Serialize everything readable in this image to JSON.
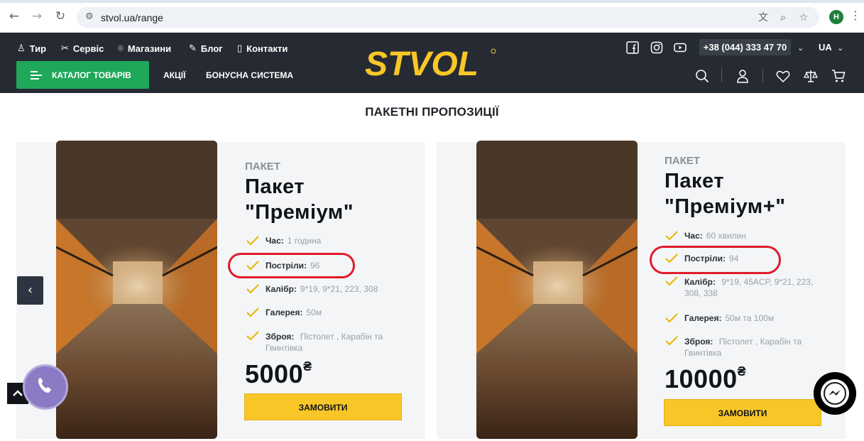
{
  "browser": {
    "url": "stvol.ua/range",
    "profile_initial": "H"
  },
  "header": {
    "top_links": [
      {
        "label": "Тир",
        "icon": "shooter-icon"
      },
      {
        "label": "Сервіс",
        "icon": "tools-icon"
      },
      {
        "label": "Магазини",
        "icon": "location-pin-icon"
      },
      {
        "label": "Блог",
        "icon": "pen-icon"
      },
      {
        "label": "Контакти",
        "icon": "phone-device-icon"
      }
    ],
    "phone": "+38 (044) 333 47 70",
    "language": "UA",
    "catalog_label": "КАТАЛОГ ТОВАРІВ",
    "nav": [
      "АКЦІЇ",
      "БОНУСНА СИСТЕМА"
    ],
    "logo_text": "STVOL",
    "colors": {
      "header_bg": "#262b33",
      "catalog_green": "#1fa75a",
      "brand_yellow": "#f8c627"
    }
  },
  "section_title": "ПАКЕТНІ ПРОПОЗИЦІЇ",
  "packages": [
    {
      "kicker": "ПАКЕТ",
      "name_line1": "Пакет",
      "name_line2": "\"Преміум\"",
      "features": [
        {
          "label": "Час:",
          "value": "1 година"
        },
        {
          "label": "Постріли:",
          "value": "96"
        },
        {
          "label": "Калібр:",
          "value": "9*19, 9*21, 223, 308"
        },
        {
          "label": "Галерея:",
          "value": "50м"
        },
        {
          "label": "Зброя:",
          "value": "Пістолет , Карабін та Гвинтівка"
        }
      ],
      "price": "5000",
      "currency": "₴",
      "order_label": "ЗАМОВИТИ"
    },
    {
      "kicker": "ПАКЕТ",
      "name_line1": "Пакет",
      "name_line2": "\"Преміум+\"",
      "features": [
        {
          "label": "Час:",
          "value": "60 хвилин"
        },
        {
          "label": "Постріли:",
          "value": "94"
        },
        {
          "label": "Калібр:",
          "value": "9*19, 45ACP, 9*21, 223, 308, 338"
        },
        {
          "label": "Галерея:",
          "value": "50м та 100м"
        },
        {
          "label": "Зброя:",
          "value": "Пістолет , Карабін та Гвинтівка"
        }
      ],
      "price": "10000",
      "currency": "₴",
      "order_label": "ЗАМОВИТИ"
    }
  ]
}
